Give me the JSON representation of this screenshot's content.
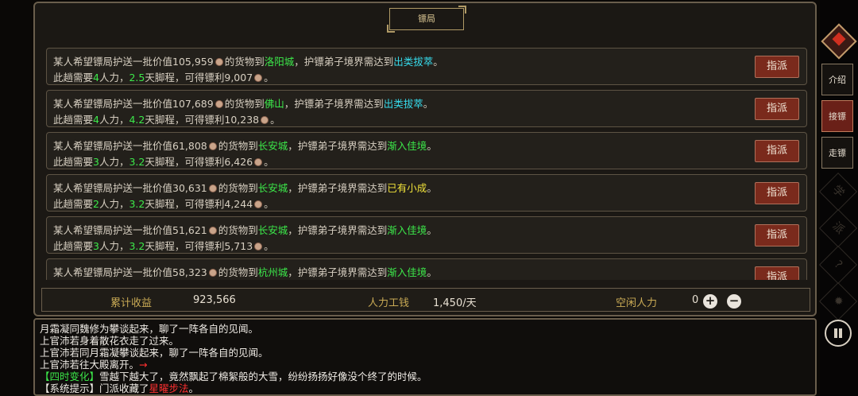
{
  "title": "镖局",
  "rows": [
    {
      "l1a": "某人希望镖局护送一批价值105,959",
      "l1b": "的货物到",
      "city": "洛阳城",
      "l1c": "，护镖弟子境界需达到",
      "realm": "出类拔萃",
      "l1d": "。",
      "l2a": "此趟需要",
      "people": "4",
      "l2b": "人力，",
      "days": "2.5",
      "l2c": "天脚程，可得镖利9,007",
      "l2d": "。",
      "button": "指派"
    },
    {
      "l1a": "某人希望镖局护送一批价值107,689",
      "l1b": "的货物到",
      "city": "佛山",
      "l1c": "，护镖弟子境界需达到",
      "realm": "出类拔萃",
      "l1d": "。",
      "l2a": "此趟需要",
      "people": "4",
      "l2b": "人力，",
      "days": "4.2",
      "l2c": "天脚程，可得镖利10,238",
      "l2d": "。",
      "button": "指派"
    },
    {
      "l1a": "某人希望镖局护送一批价值61,808",
      "l1b": "的货物到",
      "city": "长安城",
      "l1c": "，护镖弟子境界需达到",
      "realm": "渐入佳境",
      "l1d": "。",
      "l2a": "此趟需要",
      "people": "3",
      "l2b": "人力，",
      "days": "3.2",
      "l2c": "天脚程，可得镖利6,426",
      "l2d": "。",
      "button": "指派"
    },
    {
      "l1a": "某人希望镖局护送一批价值30,631",
      "l1b": "的货物到",
      "city": "长安城",
      "l1c": "，护镖弟子境界需达到",
      "realm": "已有小成",
      "l1d": "。",
      "l2a": "此趟需要",
      "people": "2",
      "l2b": "人力，",
      "days": "3.2",
      "l2c": "天脚程，可得镖利4,244",
      "l2d": "。",
      "button": "指派"
    },
    {
      "l1a": "某人希望镖局护送一批价值51,621",
      "l1b": "的货物到",
      "city": "长安城",
      "l1c": "，护镖弟子境界需达到",
      "realm": "渐入佳境",
      "l1d": "。",
      "l2a": "此趟需要",
      "people": "3",
      "l2b": "人力，",
      "days": "3.2",
      "l2c": "天脚程，可得镖利5,713",
      "l2d": "。",
      "button": "指派"
    },
    {
      "l1a": "某人希望镖局护送一批价值58,323",
      "l1b": "的货物到",
      "city": "杭州城",
      "l1c": "，护镖弟子境界需达到",
      "realm": "渐入佳境",
      "l1d": "。",
      "l2a": "",
      "people": "",
      "l2b": "",
      "days": "",
      "l2c": "",
      "l2d": "",
      "button": "指派"
    }
  ],
  "stats": {
    "income_label": "累计收益",
    "income_value": "923,566",
    "wage_label": "人力工钱",
    "wage_value": "1,450/天",
    "idle_label": "空闲人力",
    "idle_value": "0",
    "plus": "+",
    "minus": "−"
  },
  "log": {
    "l1": "月霜凝同魏修为攀谈起来，聊了一阵各自的见闻。",
    "l2": "上官沛若身着散花衣走了过来。",
    "l3": "上官沛若同月霜凝攀谈起来，聊了一阵各自的见闻。",
    "l4": "上官沛若往大殿离开。",
    "l4_arrow": "→",
    "l5_tag": "【四时变化】",
    "l5_text": "雪越下越大了，竟然飘起了棉絮般的大雪，纷纷扬扬好像没个终了的时候。",
    "l6_tag": "【系统提示】",
    "l6_text": "门派收藏了",
    "l6_item": "星曜步法",
    "l6_end": "。"
  },
  "nav": {
    "intro": "介绍",
    "accept": "接镖",
    "escort": "走镖",
    "faint1": "学",
    "faint2": "派",
    "help": "?",
    "settings": "✹"
  },
  "colors": {
    "green": "#3ce84a",
    "cyan": "#36d8e8",
    "yellow": "#f0e23a",
    "button_bg": "#7a2a1c",
    "accent_gold": "#c9aa55"
  }
}
